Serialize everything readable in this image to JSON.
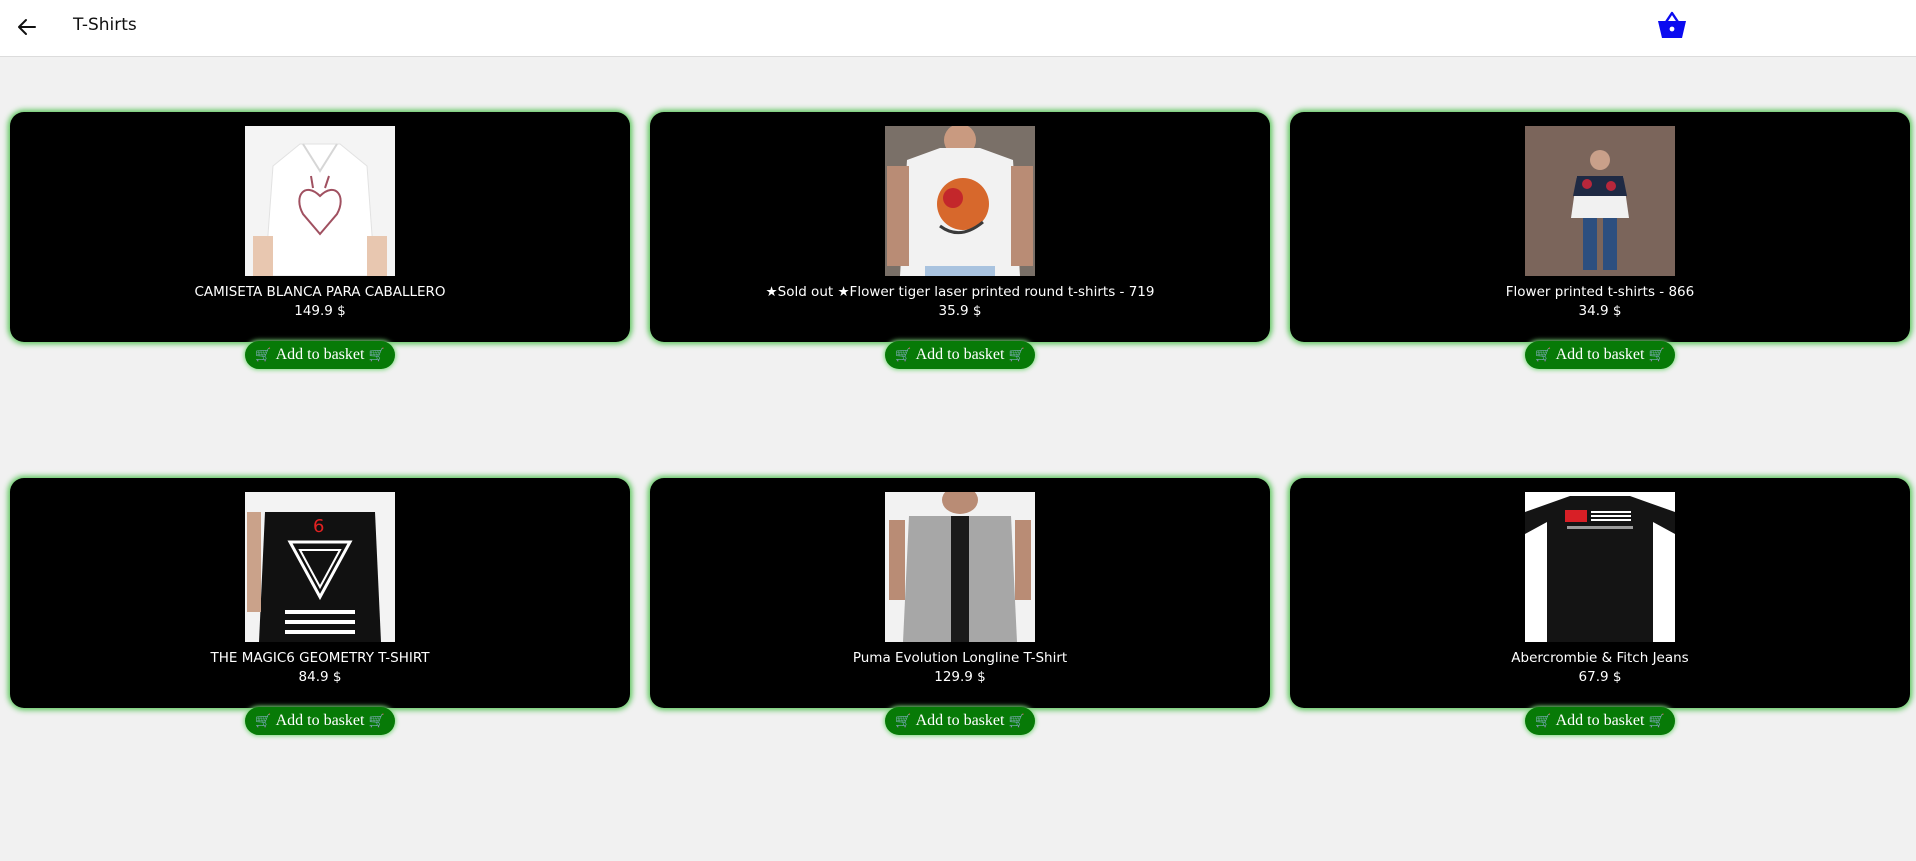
{
  "header": {
    "title": "T-Shirts",
    "back_icon": "arrow-left-icon",
    "basket_icon": "basket-icon",
    "accent": "#0b0bf0"
  },
  "colors": {
    "card_bg": "#000000",
    "card_glow": "#56c456",
    "button_bg": "#077a07"
  },
  "products": [
    {
      "name": "CAMISETA BLANCA PARA CABALLERO",
      "price": "149.9 $",
      "button_label": "Add to basket",
      "button_icon": "cart-icon"
    },
    {
      "name": "★Sold out ★Flower tiger laser printed round t-shirts - 719",
      "price": "35.9 $",
      "button_label": "Add to basket",
      "button_icon": "cart-icon"
    },
    {
      "name": "Flower printed t-shirts - 866",
      "price": "34.9 $",
      "button_label": "Add to basket",
      "button_icon": "cart-icon"
    },
    {
      "name": "THE MAGIC6 GEOMETRY T-SHIRT",
      "price": "84.9 $",
      "button_label": "Add to basket",
      "button_icon": "cart-icon"
    },
    {
      "name": "Puma Evolution Longline T-Shirt",
      "price": "129.9 $",
      "button_label": "Add to basket",
      "button_icon": "cart-icon"
    },
    {
      "name": "Abercrombie & Fitch Jeans",
      "price": "67.9 $",
      "button_label": "Add to basket",
      "button_icon": "cart-icon"
    }
  ]
}
